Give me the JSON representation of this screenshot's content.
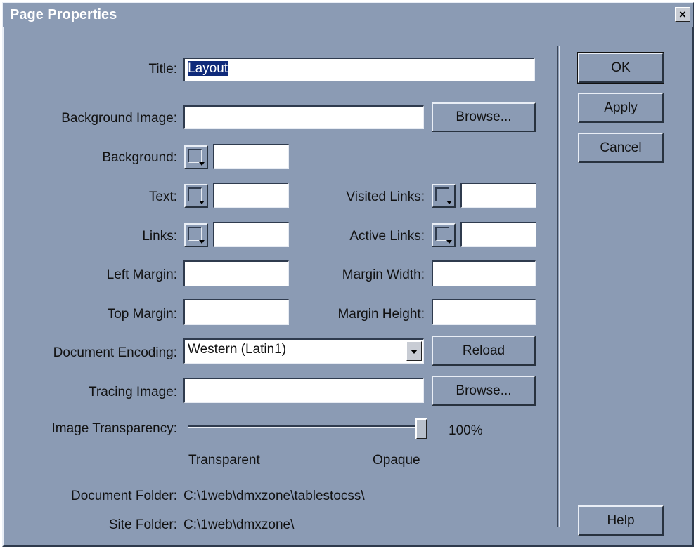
{
  "window": {
    "title": "Page Properties",
    "close_glyph": "×"
  },
  "fields": {
    "title": {
      "label": "Title:",
      "value": "Layout"
    },
    "background_image": {
      "label": "Background Image:",
      "value": ""
    },
    "background": {
      "label": "Background:",
      "value": ""
    },
    "text": {
      "label": "Text:",
      "value": ""
    },
    "links": {
      "label": "Links:",
      "value": ""
    },
    "visited_links": {
      "label": "Visited Links:",
      "value": ""
    },
    "active_links": {
      "label": "Active Links:",
      "value": ""
    },
    "left_margin": {
      "label": "Left Margin:",
      "value": ""
    },
    "top_margin": {
      "label": "Top Margin:",
      "value": ""
    },
    "margin_width": {
      "label": "Margin Width:",
      "value": ""
    },
    "margin_height": {
      "label": "Margin Height:",
      "value": ""
    },
    "document_encoding": {
      "label": "Document Encoding:",
      "value": "Western (Latin1)"
    },
    "tracing_image": {
      "label": "Tracing Image:",
      "value": ""
    }
  },
  "transparency": {
    "label": "Image Transparency:",
    "value_text": "100%",
    "value": 100,
    "min_label": "Transparent",
    "max_label": "Opaque"
  },
  "info": {
    "document_folder_label": "Document Folder:",
    "document_folder_value": "C:\\1web\\dmxzone\\tablestocss\\",
    "site_folder_label": "Site Folder:",
    "site_folder_value": "C:\\1web\\dmxzone\\"
  },
  "buttons": {
    "browse_bg": "Browse...",
    "reload": "Reload",
    "browse_tracing": "Browse...",
    "ok": "OK",
    "apply": "Apply",
    "cancel": "Cancel",
    "help": "Help"
  },
  "colors": {
    "dialog_bg": "#8b9bb4",
    "selection": "#0f2a7a"
  }
}
